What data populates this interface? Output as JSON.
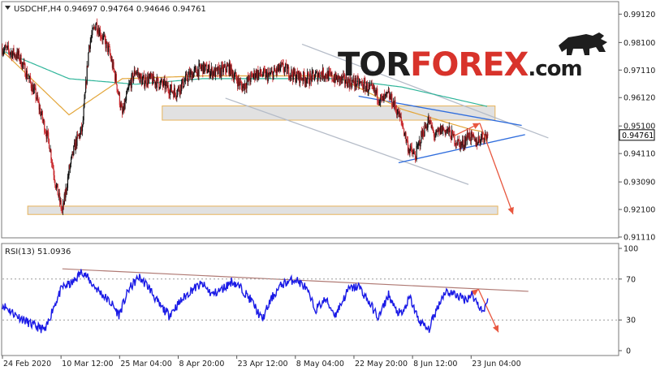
{
  "chart_data": [
    {
      "type": "candlestick",
      "title": "USDCHF,H4  0.94697 0.94764 0.94646 0.94761",
      "symbol": "USDCHF",
      "timeframe": "H4",
      "ohlc_readout": {
        "open": 0.94697,
        "high": 0.94764,
        "low": 0.94646,
        "close": 0.94761
      },
      "current_price_label": "0.94761",
      "current_price": 0.94761,
      "ylim": [
        0.9111,
        0.9954
      ],
      "y_ticks": [
        "0.99120",
        "0.98100",
        "0.97110",
        "0.96120",
        "0.95100",
        "0.94110",
        "0.93090",
        "0.92100",
        "0.91110"
      ],
      "y_tick_values": [
        0.9912,
        0.981,
        0.9711,
        0.9612,
        0.951,
        0.9411,
        0.9309,
        0.921,
        0.9111
      ],
      "x_labels": [
        "24 Feb 2020",
        "10 Mar 12:00",
        "25 Mar 04:00",
        "8 Apr 20:00",
        "23 Apr 12:00",
        "8 May 04:00",
        "22 May 20:00",
        "8 Jun 12:00",
        "23 Jun 04:00"
      ],
      "x_label_index": [
        0,
        88,
        176,
        264,
        352,
        440,
        528,
        616,
        704
      ],
      "bar_count": 730,
      "close_series": [
        [
          0,
          0.979
        ],
        [
          25,
          0.976
        ],
        [
          50,
          0.962
        ],
        [
          70,
          0.945
        ],
        [
          80,
          0.93
        ],
        [
          90,
          0.92
        ],
        [
          100,
          0.935
        ],
        [
          110,
          0.945
        ],
        [
          120,
          0.95
        ],
        [
          130,
          0.98
        ],
        [
          140,
          0.988
        ],
        [
          150,
          0.983
        ],
        [
          160,
          0.978
        ],
        [
          170,
          0.968
        ],
        [
          180,
          0.955
        ],
        [
          190,
          0.965
        ],
        [
          200,
          0.971
        ],
        [
          210,
          0.967
        ],
        [
          220,
          0.968
        ],
        [
          240,
          0.966
        ],
        [
          260,
          0.963
        ],
        [
          280,
          0.969
        ],
        [
          300,
          0.972
        ],
        [
          320,
          0.97
        ],
        [
          340,
          0.972
        ],
        [
          360,
          0.965
        ],
        [
          380,
          0.97
        ],
        [
          400,
          0.969
        ],
        [
          420,
          0.972
        ],
        [
          440,
          0.969
        ],
        [
          460,
          0.968
        ],
        [
          480,
          0.97
        ],
        [
          500,
          0.968
        ],
        [
          520,
          0.967
        ],
        [
          540,
          0.966
        ],
        [
          560,
          0.963
        ],
        [
          570,
          0.96
        ],
        [
          580,
          0.962
        ],
        [
          590,
          0.958
        ],
        [
          600,
          0.952
        ],
        [
          610,
          0.943
        ],
        [
          620,
          0.94
        ],
        [
          630,
          0.948
        ],
        [
          640,
          0.953
        ],
        [
          650,
          0.947
        ],
        [
          660,
          0.95
        ],
        [
          670,
          0.949
        ],
        [
          680,
          0.946
        ],
        [
          690,
          0.944
        ],
        [
          700,
          0.948
        ],
        [
          710,
          0.945
        ],
        [
          720,
          0.9472
        ],
        [
          729,
          0.9476
        ]
      ],
      "moving_averages": [
        {
          "color": "#e3a63a",
          "points": [
            [
              0,
              0.978
            ],
            [
              100,
              0.955
            ],
            [
              180,
              0.968
            ],
            [
              300,
              0.969
            ],
            [
              500,
              0.969
            ],
            [
              600,
              0.957
            ],
            [
              700,
              0.95
            ],
            [
              720,
              0.949
            ]
          ]
        },
        {
          "color": "#2fb59a",
          "points": [
            [
              0,
              0.978
            ],
            [
              100,
              0.968
            ],
            [
              200,
              0.966
            ],
            [
              300,
              0.968
            ],
            [
              500,
              0.968
            ],
            [
              600,
              0.965
            ],
            [
              729,
              0.958
            ]
          ]
        }
      ],
      "support_resistance_zones": [
        {
          "from": 0.9582,
          "to": 0.9531,
          "start_index": 240,
          "end_index": 740
        },
        {
          "from": 0.9222,
          "to": 0.9192,
          "start_index": 38,
          "end_index": 744
        }
      ],
      "trend_lines": [
        {
          "color": "#b5bcc8",
          "from": [
            450,
            0.9804
          ],
          "to": [
            820,
            0.9467
          ]
        },
        {
          "color": "#b5bcc8",
          "from": [
            335,
            0.961
          ],
          "to": [
            700,
            0.93
          ]
        },
        {
          "color": "#2f6ddd",
          "from": [
            535,
            0.9617
          ],
          "to": [
            780,
            0.9512
          ]
        },
        {
          "color": "#2f6ddd",
          "from": [
            595,
            0.9378
          ],
          "to": [
            785,
            0.9479
          ]
        }
      ],
      "forecast_arrows": [
        {
          "color": "#e8573f",
          "from": [
            678,
            0.9474
          ],
          "to": [
            717,
            0.952
          ]
        },
        {
          "color": "#e8573f",
          "from": [
            717,
            0.952
          ],
          "to": [
            767,
            0.9193
          ]
        }
      ],
      "logo": "TORFOREX.com"
    },
    {
      "type": "line",
      "title": "RSI(13) 51.0936",
      "indicator": "RSI",
      "period": 13,
      "current_value": 51.0936,
      "ylim": [
        0,
        100
      ],
      "y_ticks": [
        "100",
        "70",
        "30",
        "0"
      ],
      "y_tick_values": [
        100,
        70,
        30,
        0
      ],
      "levels": [
        70,
        30
      ],
      "series": [
        [
          0,
          45
        ],
        [
          20,
          35
        ],
        [
          45,
          25
        ],
        [
          65,
          20
        ],
        [
          75,
          40
        ],
        [
          90,
          62
        ],
        [
          105,
          66
        ],
        [
          120,
          78
        ],
        [
          135,
          65
        ],
        [
          150,
          55
        ],
        [
          165,
          45
        ],
        [
          175,
          35
        ],
        [
          190,
          60
        ],
        [
          205,
          72
        ],
        [
          220,
          62
        ],
        [
          235,
          45
        ],
        [
          250,
          35
        ],
        [
          270,
          50
        ],
        [
          285,
          60
        ],
        [
          300,
          65
        ],
        [
          315,
          55
        ],
        [
          330,
          60
        ],
        [
          345,
          68
        ],
        [
          360,
          60
        ],
        [
          375,
          48
        ],
        [
          390,
          30
        ],
        [
          405,
          52
        ],
        [
          420,
          65
        ],
        [
          440,
          70
        ],
        [
          455,
          62
        ],
        [
          470,
          40
        ],
        [
          485,
          50
        ],
        [
          500,
          35
        ],
        [
          520,
          60
        ],
        [
          535,
          63
        ],
        [
          550,
          48
        ],
        [
          565,
          32
        ],
        [
          580,
          55
        ],
        [
          590,
          40
        ],
        [
          600,
          35
        ],
        [
          612,
          52
        ],
        [
          625,
          30
        ],
        [
          640,
          20
        ],
        [
          655,
          45
        ],
        [
          665,
          58
        ],
        [
          680,
          55
        ],
        [
          695,
          50
        ],
        [
          705,
          55
        ],
        [
          715,
          45
        ],
        [
          722,
          38
        ],
        [
          729,
          51.09
        ]
      ],
      "trend_lines": [
        {
          "color": "#b07a74",
          "from": [
            90,
            80
          ],
          "to": [
            790,
            58
          ]
        }
      ],
      "forecast_arrows": [
        {
          "color": "#e8573f",
          "from": [
            700,
            53
          ],
          "to": [
            715,
            60
          ]
        },
        {
          "color": "#e8573f",
          "from": [
            715,
            60
          ],
          "to": [
            745,
            18
          ]
        }
      ]
    }
  ]
}
